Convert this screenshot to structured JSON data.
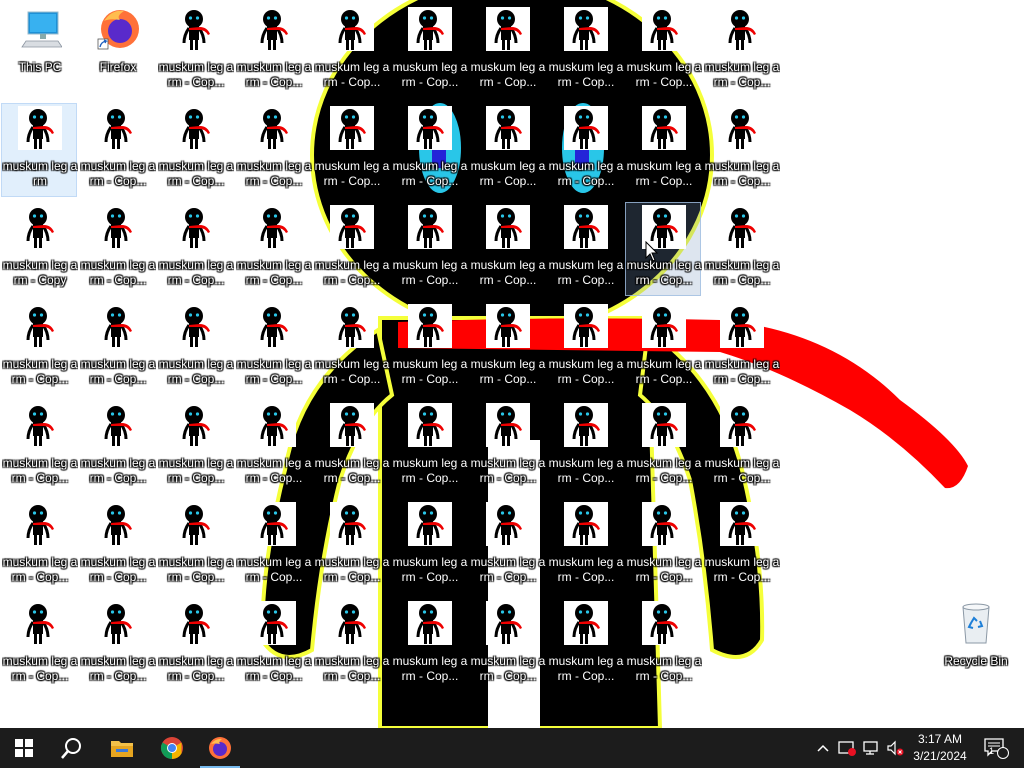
{
  "desktop": {
    "this_pc_label": "This PC",
    "firefox_label": "Firefox",
    "recycle_bin_label": "Recycle Bin",
    "original_shortcut_label": "muskum leg arm",
    "copy_label": "muskum leg arm - Copy",
    "copy_label_truncated": "muskum leg arm - Cop...",
    "selected_icon_index": 10,
    "hovered_icon_index": 28
  },
  "taskbar": {
    "start": "start-icon",
    "search": "search-icon",
    "apps": [
      "File Explorer",
      "Google Chrome",
      "Firefox"
    ],
    "tray_icons": [
      "chevron-up-icon",
      "security-warning-icon",
      "network-disconnected-icon",
      "speaker-muted-icon"
    ],
    "time": "3:17 AM",
    "date": "3/21/2024",
    "notification_count": "1"
  },
  "colors": {
    "taskbar_bg": "#1c1c1c",
    "wallpaper_body": "#000000",
    "wallpaper_outline": "#f5ff3a",
    "scarf": "#ff0000",
    "eye": "#29c6e8"
  }
}
